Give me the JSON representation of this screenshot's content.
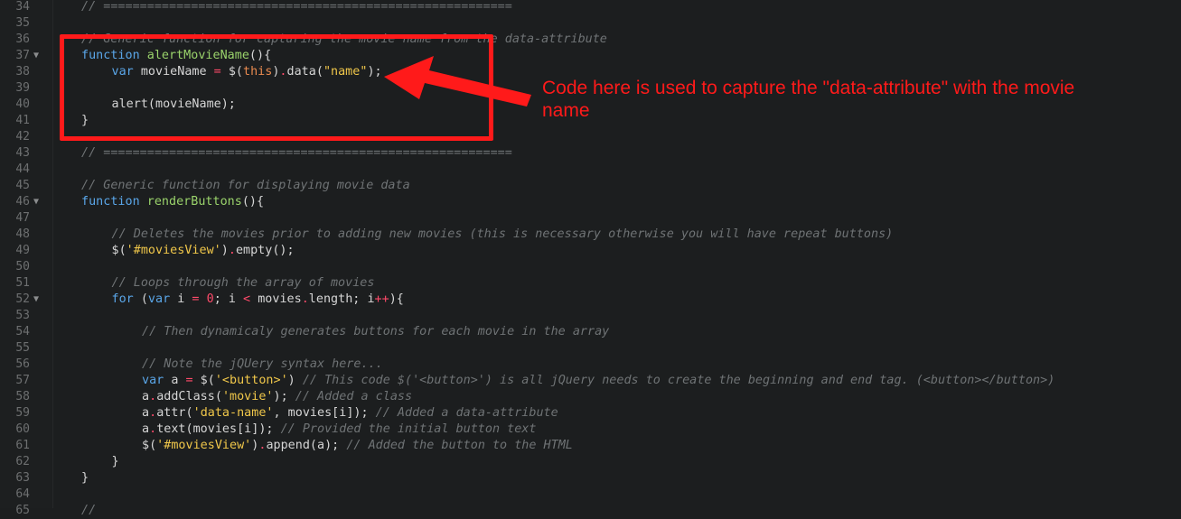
{
  "annotation": {
    "text": "Code here is used to capture the \"data-attribute\" with the movie name",
    "color": "#ff1a1a"
  },
  "colors": {
    "background": "#1c1e1f",
    "comment": "#6f7375",
    "keyword": "#5aa6e8",
    "function_name": "#9ad36b",
    "operator": "#ff4a6a",
    "string": "#f0c74a",
    "this": "#e88a4f"
  },
  "lines": [
    {
      "num": "34",
      "fold": "",
      "indent": 0,
      "tokens": [
        {
          "t": "// ========================================================",
          "c": "comment"
        }
      ]
    },
    {
      "num": "35",
      "fold": "",
      "indent": 0,
      "tokens": []
    },
    {
      "num": "36",
      "fold": "",
      "indent": 0,
      "tokens": [
        {
          "t": "// Generic function for capturing the movie name from the data-attribute",
          "c": "comment"
        }
      ]
    },
    {
      "num": "37",
      "fold": "▼",
      "indent": 0,
      "tokens": [
        {
          "t": "function ",
          "c": "kw"
        },
        {
          "t": "alertMovieName",
          "c": "fn"
        },
        {
          "t": "(){",
          "c": "text"
        }
      ]
    },
    {
      "num": "38",
      "fold": "",
      "indent": 1,
      "tokens": [
        {
          "t": "var ",
          "c": "kw"
        },
        {
          "t": "movieName ",
          "c": "text"
        },
        {
          "t": "=",
          "c": "op"
        },
        {
          "t": " $(",
          "c": "text"
        },
        {
          "t": "this",
          "c": "this"
        },
        {
          "t": ")",
          "c": "text"
        },
        {
          "t": ".",
          "c": "op"
        },
        {
          "t": "data(",
          "c": "text"
        },
        {
          "t": "\"name\"",
          "c": "str"
        },
        {
          "t": ");",
          "c": "text"
        }
      ]
    },
    {
      "num": "39",
      "fold": "",
      "indent": 0,
      "tokens": []
    },
    {
      "num": "40",
      "fold": "",
      "indent": 1,
      "tokens": [
        {
          "t": "alert(movieName);",
          "c": "text"
        }
      ]
    },
    {
      "num": "41",
      "fold": "",
      "indent": 0,
      "tokens": [
        {
          "t": "}",
          "c": "text"
        }
      ]
    },
    {
      "num": "42",
      "fold": "",
      "indent": 0,
      "tokens": []
    },
    {
      "num": "43",
      "fold": "",
      "indent": 0,
      "tokens": [
        {
          "t": "// ========================================================",
          "c": "comment"
        }
      ]
    },
    {
      "num": "44",
      "fold": "",
      "indent": 0,
      "tokens": []
    },
    {
      "num": "45",
      "fold": "",
      "indent": 0,
      "tokens": [
        {
          "t": "// Generic function for displaying movie data",
          "c": "comment"
        }
      ]
    },
    {
      "num": "46",
      "fold": "▼",
      "indent": 0,
      "tokens": [
        {
          "t": "function ",
          "c": "kw"
        },
        {
          "t": "renderButtons",
          "c": "fn"
        },
        {
          "t": "(){",
          "c": "text"
        }
      ]
    },
    {
      "num": "47",
      "fold": "",
      "indent": 0,
      "tokens": []
    },
    {
      "num": "48",
      "fold": "",
      "indent": 1,
      "tokens": [
        {
          "t": "// Deletes the movies prior to adding new movies (this is necessary otherwise you will have repeat buttons)",
          "c": "comment"
        }
      ]
    },
    {
      "num": "49",
      "fold": "",
      "indent": 1,
      "tokens": [
        {
          "t": "$(",
          "c": "text"
        },
        {
          "t": "'#moviesView'",
          "c": "str"
        },
        {
          "t": ")",
          "c": "text"
        },
        {
          "t": ".",
          "c": "op"
        },
        {
          "t": "empty();",
          "c": "text"
        }
      ]
    },
    {
      "num": "50",
      "fold": "",
      "indent": 0,
      "tokens": []
    },
    {
      "num": "51",
      "fold": "",
      "indent": 1,
      "tokens": [
        {
          "t": "// Loops through the array of movies",
          "c": "comment"
        }
      ]
    },
    {
      "num": "52",
      "fold": "▼",
      "indent": 1,
      "tokens": [
        {
          "t": "for ",
          "c": "kw"
        },
        {
          "t": "(",
          "c": "text"
        },
        {
          "t": "var ",
          "c": "kw"
        },
        {
          "t": "i ",
          "c": "text"
        },
        {
          "t": "=",
          "c": "op"
        },
        {
          "t": " ",
          "c": "text"
        },
        {
          "t": "0",
          "c": "op"
        },
        {
          "t": "; i ",
          "c": "text"
        },
        {
          "t": "<",
          "c": "op"
        },
        {
          "t": " movies",
          "c": "text"
        },
        {
          "t": ".",
          "c": "op"
        },
        {
          "t": "length; i",
          "c": "text"
        },
        {
          "t": "++",
          "c": "op"
        },
        {
          "t": "){",
          "c": "text"
        }
      ]
    },
    {
      "num": "53",
      "fold": "",
      "indent": 0,
      "tokens": []
    },
    {
      "num": "54",
      "fold": "",
      "indent": 2,
      "tokens": [
        {
          "t": "// Then dynamicaly generates buttons for each movie in the array",
          "c": "comment"
        }
      ]
    },
    {
      "num": "55",
      "fold": "",
      "indent": 0,
      "tokens": []
    },
    {
      "num": "56",
      "fold": "",
      "indent": 2,
      "tokens": [
        {
          "t": "// Note the jQUery syntax here...",
          "c": "comment"
        }
      ]
    },
    {
      "num": "57",
      "fold": "",
      "indent": 2,
      "tokens": [
        {
          "t": "var ",
          "c": "kw"
        },
        {
          "t": "a ",
          "c": "text"
        },
        {
          "t": "=",
          "c": "op"
        },
        {
          "t": " $(",
          "c": "text"
        },
        {
          "t": "'<button>'",
          "c": "str"
        },
        {
          "t": ") ",
          "c": "text"
        },
        {
          "t": "// This code $('<button>') is all jQuery needs to create the beginning and end tag. (<button></button>)",
          "c": "comment"
        }
      ]
    },
    {
      "num": "58",
      "fold": "",
      "indent": 2,
      "tokens": [
        {
          "t": "a",
          "c": "text"
        },
        {
          "t": ".",
          "c": "op"
        },
        {
          "t": "addClass(",
          "c": "text"
        },
        {
          "t": "'movie'",
          "c": "str"
        },
        {
          "t": "); ",
          "c": "text"
        },
        {
          "t": "// Added a class",
          "c": "comment"
        }
      ]
    },
    {
      "num": "59",
      "fold": "",
      "indent": 2,
      "tokens": [
        {
          "t": "a",
          "c": "text"
        },
        {
          "t": ".",
          "c": "op"
        },
        {
          "t": "attr(",
          "c": "text"
        },
        {
          "t": "'data-name'",
          "c": "str"
        },
        {
          "t": ", movies[i]); ",
          "c": "text"
        },
        {
          "t": "// Added a data-attribute",
          "c": "comment"
        }
      ]
    },
    {
      "num": "60",
      "fold": "",
      "indent": 2,
      "tokens": [
        {
          "t": "a",
          "c": "text"
        },
        {
          "t": ".",
          "c": "op"
        },
        {
          "t": "text(movies[i]); ",
          "c": "text"
        },
        {
          "t": "// Provided the initial button text",
          "c": "comment"
        }
      ]
    },
    {
      "num": "61",
      "fold": "",
      "indent": 2,
      "tokens": [
        {
          "t": "$(",
          "c": "text"
        },
        {
          "t": "'#moviesView'",
          "c": "str"
        },
        {
          "t": ")",
          "c": "text"
        },
        {
          "t": ".",
          "c": "op"
        },
        {
          "t": "append(a); ",
          "c": "text"
        },
        {
          "t": "// Added the button to the HTML",
          "c": "comment"
        }
      ]
    },
    {
      "num": "62",
      "fold": "",
      "indent": 1,
      "tokens": [
        {
          "t": "}",
          "c": "text"
        }
      ]
    },
    {
      "num": "63",
      "fold": "",
      "indent": 0,
      "tokens": [
        {
          "t": "}",
          "c": "text"
        }
      ]
    },
    {
      "num": "64",
      "fold": "",
      "indent": 0,
      "tokens": []
    },
    {
      "num": "65",
      "fold": "",
      "indent": 0,
      "tokens": [
        {
          "t": "//",
          "c": "comment"
        }
      ]
    }
  ]
}
